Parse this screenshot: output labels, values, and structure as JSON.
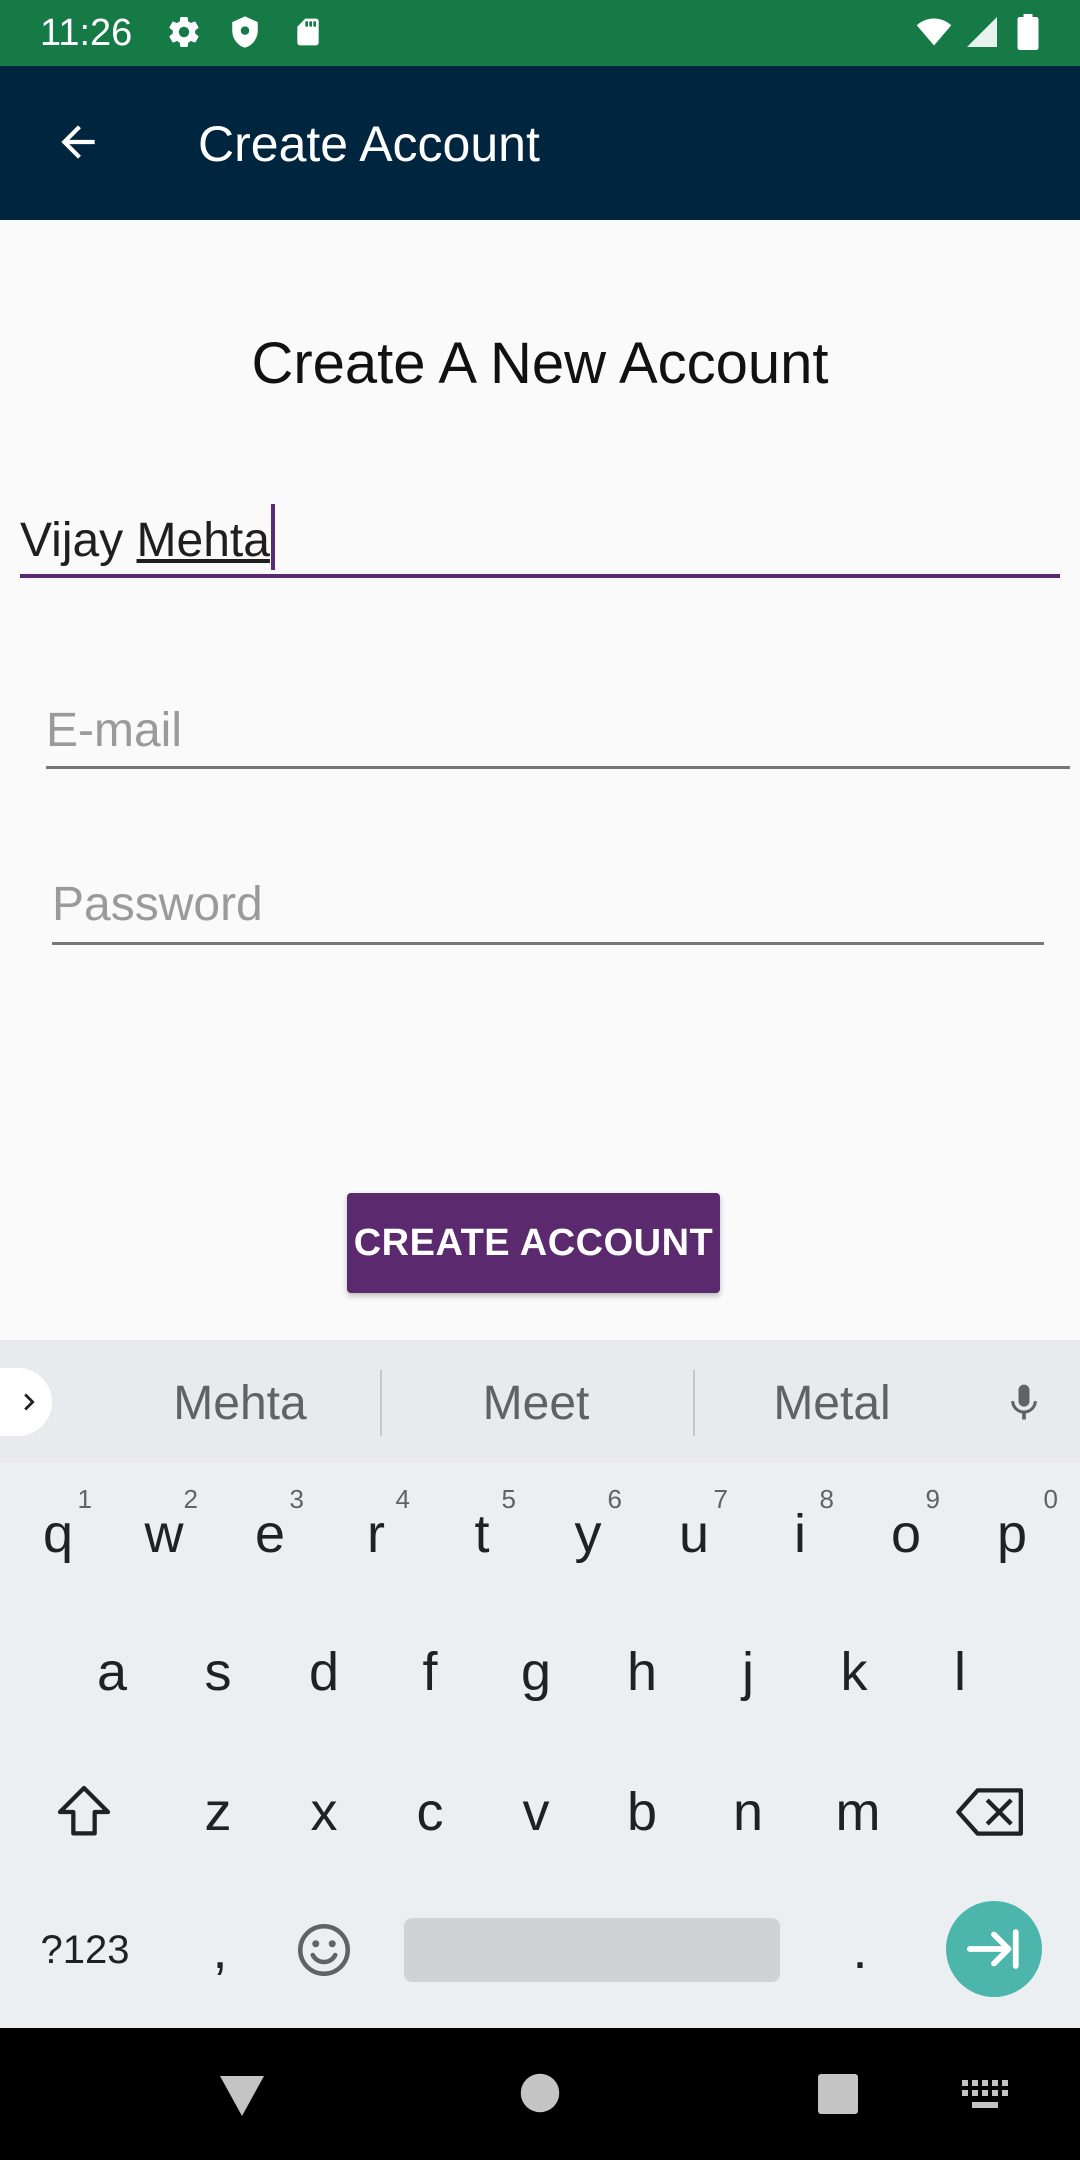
{
  "status_bar": {
    "time": "11:26",
    "left_icons": [
      "gear-icon",
      "shield-icon",
      "sd-card-icon"
    ],
    "right_icons": [
      "wifi-icon",
      "signal-icon",
      "battery-icon"
    ],
    "color": "#167a47"
  },
  "app_bar": {
    "title": "Create Account",
    "back_icon": "arrow-left-icon",
    "color": "#00253f"
  },
  "form": {
    "heading": "Create A New  Account",
    "name": {
      "first": "Vijay ",
      "last": "Mehta"
    },
    "email": {
      "placeholder": "E-mail",
      "value": ""
    },
    "password": {
      "placeholder": "Password",
      "value": ""
    },
    "submit_label": "CREATE ACCOUNT",
    "accent_color": "#5b2a6e"
  },
  "keyboard": {
    "suggestions": [
      "Mehta",
      "Meet",
      "Metal"
    ],
    "row1": [
      "q",
      "w",
      "e",
      "r",
      "t",
      "y",
      "u",
      "i",
      "o",
      "p"
    ],
    "row1_hints": [
      "1",
      "2",
      "3",
      "4",
      "5",
      "6",
      "7",
      "8",
      "9",
      "0"
    ],
    "row2": [
      "a",
      "s",
      "d",
      "f",
      "g",
      "h",
      "j",
      "k",
      "l"
    ],
    "row3": [
      "z",
      "x",
      "c",
      "v",
      "b",
      "n",
      "m"
    ],
    "symbols_label": "?123",
    "comma": ",",
    "period": ".",
    "enter_color": "#4db6ac"
  },
  "nav_bar": {
    "icons": [
      "back-triangle-icon",
      "home-circle-icon",
      "recents-square-icon",
      "keyboard-switch-icon"
    ]
  }
}
